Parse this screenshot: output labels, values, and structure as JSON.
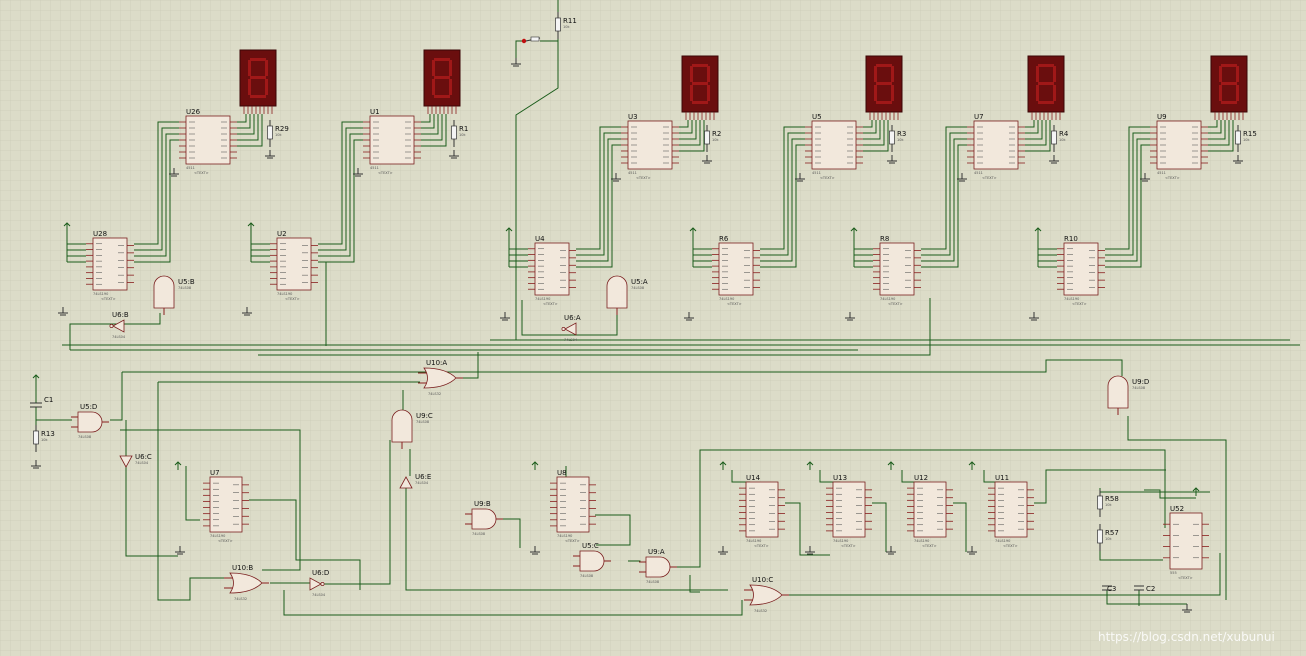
{
  "labels": {
    "display_ics": [
      "U26",
      "U1",
      "U3",
      "U5",
      "U7",
      "U9"
    ],
    "counter_ics": [
      "U28",
      "U2",
      "U4",
      "R6",
      "R8",
      "R10",
      "U7",
      "U8",
      "U14",
      "U13",
      "U12",
      "U11"
    ],
    "resistors": [
      "R29",
      "R1",
      "R2",
      "R3",
      "R4",
      "R15",
      "R11",
      "R13",
      "R58",
      "R57"
    ],
    "capacitors": [
      "C1",
      "C2",
      "C3"
    ],
    "gates": [
      "U5:B",
      "U6:B",
      "U5:A",
      "U6:A",
      "U5:D",
      "U6:C",
      "U10:A",
      "U9:C",
      "U6:E",
      "U9:D",
      "U10:B",
      "U6:D",
      "U9:B",
      "U5:C",
      "U9:A",
      "U10:C"
    ],
    "timer": "U52",
    "part_counter": "74LS190",
    "part_decoder": "4511",
    "part_and": "74LS08",
    "part_or": "74LS32",
    "part_not": "74LS04",
    "part_555": "555",
    "text_placeholder": "<TEXT>",
    "res_value": "10k"
  },
  "watermark": "https://blog.csdn.net/xubunui",
  "colors": {
    "background": "#dcdcc8",
    "wire": "#1a5c1a",
    "ic_fill": "#f2e8dc",
    "ic_border": "#7a1e1e",
    "pin": "#8a1e1e",
    "display_body": "#6a0e0e",
    "display_segment": "#a01818"
  }
}
